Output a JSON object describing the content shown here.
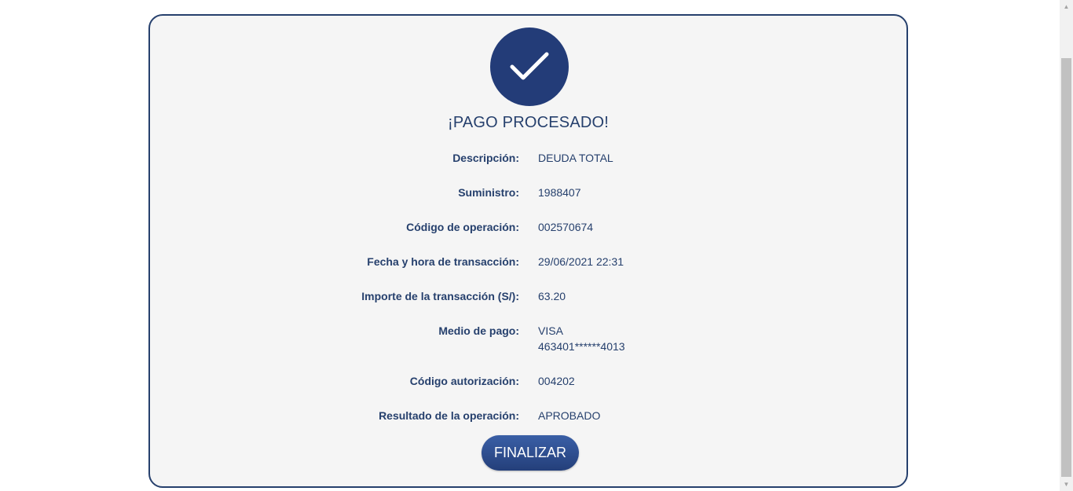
{
  "status": {
    "title": "¡PAGO PROCESADO!",
    "icon": "check-icon",
    "accent_color": "#233c78"
  },
  "details": {
    "descripcion": {
      "label": "Descripción:",
      "value": "DEUDA TOTAL"
    },
    "suministro": {
      "label": "Suministro:",
      "value": "1988407"
    },
    "codigo_operacion": {
      "label": "Código de operación:",
      "value": "002570674"
    },
    "fecha_hora": {
      "label": "Fecha y hora de transacción:",
      "value": "29/06/2021 22:31"
    },
    "importe": {
      "label": "Importe de la transacción (S/):",
      "value": "63.20"
    },
    "medio_pago": {
      "label": "Medio de pago:",
      "value_line1": "VISA",
      "value_line2": "463401******4013"
    },
    "codigo_autorizacion": {
      "label": "Código autorización:",
      "value": "004202"
    },
    "resultado": {
      "label": "Resultado de la operación:",
      "value": "APROBADO"
    }
  },
  "actions": {
    "finish_label": "FINALIZAR"
  }
}
